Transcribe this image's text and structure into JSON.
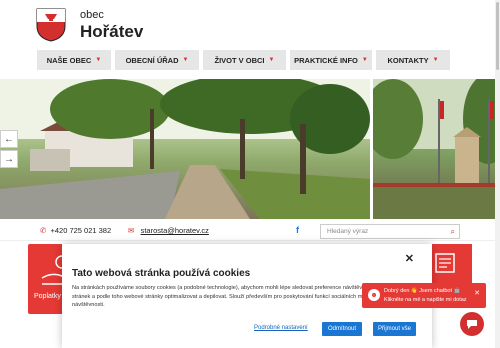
{
  "header": {
    "obec_label": "obec",
    "town_name": "Hořátev"
  },
  "nav": [
    {
      "label": "NAŠE OBEC"
    },
    {
      "label": "OBECNÍ ÚŘAD"
    },
    {
      "label": "ŽIVOT V OBCI"
    },
    {
      "label": "PRAKTICKÉ INFO"
    },
    {
      "label": "KONTAKTY"
    }
  ],
  "contact": {
    "phone": "+420 725 021 382",
    "email": "starosta@horatev.cz",
    "search_placeholder": "Hledaný výraz"
  },
  "quick_links": {
    "left_label": "Poplatky"
  },
  "cookie": {
    "title": "Tato webová stránka používá cookies",
    "text": "Na stránkách používáme soubory cookies (a podobné technologie), abychom mohli lépe sledovat preference návštěvníků a nabízet obsah stránek a podle toho webové stránky optimalizovat a depilovat. Slouží především pro poskytování funkcí sociálních médií a analýzu naší návštěvnosti.",
    "settings_label": "Podrobné nastavení",
    "reject_label": "Odmítnout",
    "accept_label": "Přijmout vše"
  },
  "chat": {
    "line1": "Dobrý den 👋 Jsem chatbot 🤖",
    "line2": "Klikněte na mě a napište mi dotaz"
  },
  "colors": {
    "accent": "#e53935",
    "button": "#1976d2"
  }
}
